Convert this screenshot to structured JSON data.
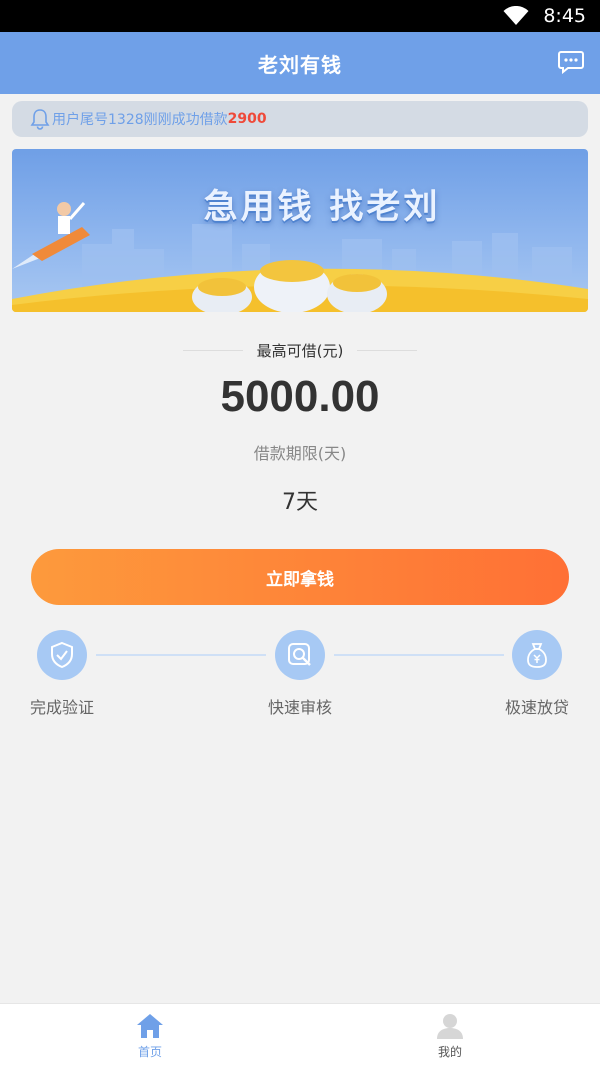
{
  "status_bar": {
    "time": "8:45"
  },
  "header": {
    "title": "老刘有钱",
    "message_icon": "chat-bubble-icon"
  },
  "notice": {
    "text": "用户尾号1328刚刚成功借款",
    "amount": "2900"
  },
  "banner": {
    "slogan": "急用钱 找老刘"
  },
  "loan": {
    "max_label": "最高可借(元)",
    "max_amount": "5000.00",
    "term_label": "借款期限(天)",
    "term_value": "7天"
  },
  "cta": {
    "label": "立即拿钱"
  },
  "steps": [
    {
      "label": "完成验证",
      "icon": "shield-check-icon"
    },
    {
      "label": "快速审核",
      "icon": "search-review-icon"
    },
    {
      "label": "极速放贷",
      "icon": "money-bag-icon"
    }
  ],
  "tabs": [
    {
      "label": "首页",
      "icon": "home-icon",
      "active": true
    },
    {
      "label": "我的",
      "icon": "user-icon",
      "active": false
    }
  ],
  "colors": {
    "primary": "#6fa0e8",
    "accent_orange": "#ff7035",
    "highlight_red": "#ef4a3a"
  }
}
